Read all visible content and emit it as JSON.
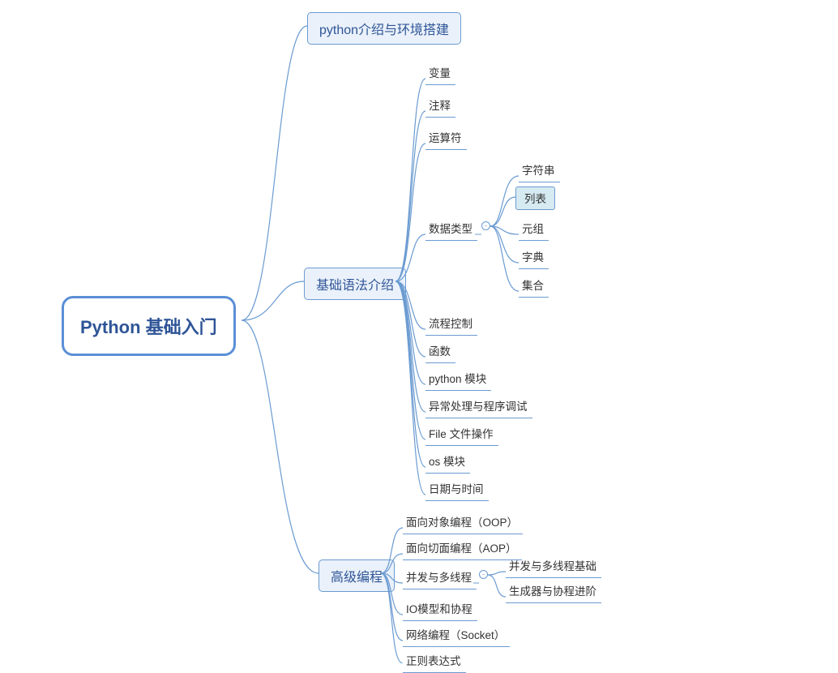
{
  "root": {
    "label": "Python 基础入门"
  },
  "branches": [
    {
      "id": "b1",
      "label": "python介绍与环境搭建",
      "children": []
    },
    {
      "id": "b2",
      "label": "基础语法介绍",
      "children": [
        {
          "label": "变量"
        },
        {
          "label": "注释"
        },
        {
          "label": "运算符"
        },
        {
          "label": "数据类型",
          "expanded": true,
          "children": [
            {
              "label": "字符串"
            },
            {
              "label": "列表",
              "selected": true
            },
            {
              "label": "元组"
            },
            {
              "label": "字典"
            },
            {
              "label": "集合"
            }
          ]
        },
        {
          "label": "流程控制"
        },
        {
          "label": "函数"
        },
        {
          "label": "python 模块"
        },
        {
          "label": "异常处理与程序调试"
        },
        {
          "label": "File 文件操作"
        },
        {
          "label": "os 模块"
        },
        {
          "label": "日期与时间"
        }
      ]
    },
    {
      "id": "b3",
      "label": "高级编程",
      "children": [
        {
          "label": "面向对象编程（OOP）"
        },
        {
          "label": "面向切面编程（AOP）"
        },
        {
          "label": "并发与多线程",
          "expanded": true,
          "children": [
            {
              "label": "并发与多线程基础"
            },
            {
              "label": "生成器与协程进阶"
            }
          ]
        },
        {
          "label": "IO模型和协程"
        },
        {
          "label": "网络编程（Socket）"
        },
        {
          "label": "正则表达式"
        }
      ]
    }
  ]
}
